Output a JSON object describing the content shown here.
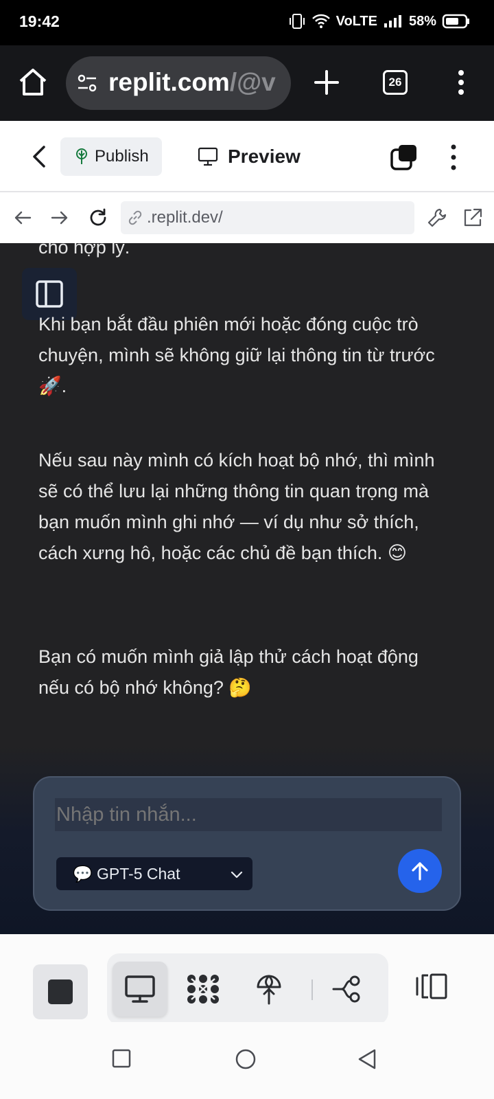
{
  "status_bar": {
    "time": "19:42",
    "network": "VoLTE",
    "battery": "58%",
    "icons": [
      "vibrate-icon",
      "wifi-icon",
      "signal-icon",
      "battery-icon"
    ]
  },
  "browser": {
    "url_main": "replit.com",
    "url_rest": "/@v",
    "tab_count": "26",
    "icons": [
      "home-icon",
      "site-settings-icon",
      "new-tab-icon",
      "tab-switcher-icon",
      "more-icon"
    ]
  },
  "replit_header": {
    "publish_label": "Publish",
    "preview_label": "Preview"
  },
  "preview_bar": {
    "url": ".replit.dev/"
  },
  "chat": {
    "paragraphs": [
      "cho hợp lý.",
      "Khi bạn bắt đầu phiên mới hoặc đóng cuộc trò chuyện, mình sẽ không giữ lại thông tin từ trước 🚀.",
      "Nếu sau này mình có kích hoạt bộ nhớ, thì mình sẽ có thể lưu lại những thông tin quan trọng mà bạn muốn mình ghi nhớ — ví dụ như sở thích, cách xưng hô, hoặc các chủ đề bạn thích. 😊",
      "Bạn có muốn mình giả lập thử cách hoạt động nếu có bộ nhớ không? 🤔"
    ]
  },
  "composer": {
    "placeholder": "Nhập tin nhắn...",
    "model_label": "💬 GPT-5 Chat",
    "send_color": "#2563eb"
  },
  "toolbar": {
    "tools": [
      "stop-icon",
      "preview-monitor-icon",
      "workspace-grid-icon",
      "publish-antenna-icon",
      "git-branch-icon",
      "layout-panels-icon"
    ]
  }
}
